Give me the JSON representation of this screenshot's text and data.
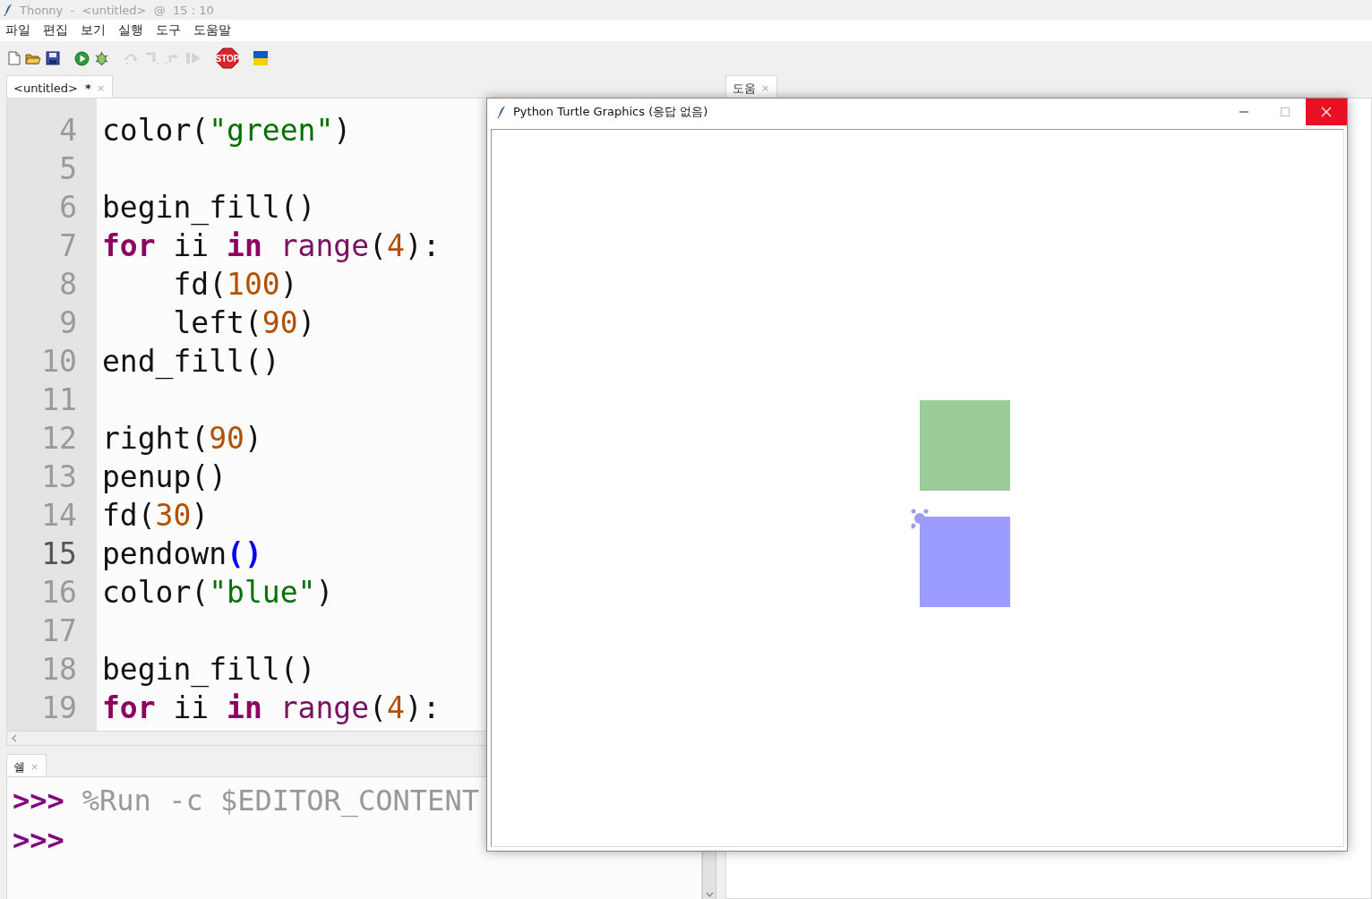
{
  "title_bar": {
    "text": "Thonny  -  <untitled>  @  15 : 10"
  },
  "menu": [
    "파일",
    "편집",
    "보기",
    "실행",
    "도구",
    "도움말"
  ],
  "toolbar": {
    "groups": [
      {
        "buttons": [
          {
            "kind": "new",
            "disabled": false
          },
          {
            "kind": "open",
            "disabled": false
          },
          {
            "kind": "save",
            "disabled": false
          }
        ]
      },
      {
        "buttons": [
          {
            "kind": "run",
            "disabled": false
          },
          {
            "kind": "debug",
            "disabled": false
          }
        ]
      },
      {
        "buttons": [
          {
            "kind": "step-over",
            "disabled": true
          },
          {
            "kind": "step-into",
            "disabled": true
          },
          {
            "kind": "step-out",
            "disabled": true
          },
          {
            "kind": "resume",
            "disabled": true
          }
        ]
      },
      {
        "buttons": [
          {
            "kind": "stop",
            "disabled": false,
            "label": "STOP"
          }
        ]
      },
      {
        "buttons": [
          {
            "kind": "flag",
            "disabled": false
          }
        ]
      }
    ]
  },
  "editor_tabs": [
    {
      "label": "<untitled>",
      "modified_mark": "*",
      "close": "×",
      "selected": true
    }
  ],
  "editor": {
    "lines": [
      {
        "number": "4",
        "current": false,
        "tokens": [
          {
            "text": "color(",
            "kind": "plain"
          },
          {
            "text": "\"green\"",
            "kind": "string"
          },
          {
            "text": ")",
            "kind": "plain"
          }
        ]
      },
      {
        "number": "5",
        "current": false
      },
      {
        "number": "6",
        "current": false,
        "tokens": [
          {
            "text": "begin_fill()",
            "kind": "plain"
          }
        ]
      },
      {
        "number": "7",
        "current": false,
        "tokens": [
          {
            "text": "for",
            "kind": "keyword"
          },
          {
            "text": " ii ",
            "kind": "plain"
          },
          {
            "text": "in",
            "kind": "keyword"
          },
          {
            "text": " range",
            "kind": "builtin"
          },
          {
            "text": "(",
            "kind": "plain"
          },
          {
            "text": "4",
            "kind": "number"
          },
          {
            "text": "):",
            "kind": "plain"
          }
        ]
      },
      {
        "number": "8",
        "current": false,
        "tokens": [
          {
            "text": "    fd(",
            "kind": "plain"
          },
          {
            "text": "100",
            "kind": "number"
          },
          {
            "text": ")",
            "kind": "plain"
          }
        ]
      },
      {
        "number": "9",
        "current": false,
        "tokens": [
          {
            "text": "    left(",
            "kind": "plain"
          },
          {
            "text": "90",
            "kind": "number"
          },
          {
            "text": ")",
            "kind": "plain"
          }
        ]
      },
      {
        "number": "10",
        "current": false,
        "tokens": [
          {
            "text": "end_fill()",
            "kind": "plain"
          }
        ]
      },
      {
        "number": "11",
        "current": false
      },
      {
        "number": "12",
        "current": false,
        "tokens": [
          {
            "text": "right(",
            "kind": "plain"
          },
          {
            "text": "90",
            "kind": "number"
          },
          {
            "text": ")",
            "kind": "plain"
          }
        ]
      },
      {
        "number": "13",
        "current": false,
        "tokens": [
          {
            "text": "penup()",
            "kind": "plain"
          }
        ]
      },
      {
        "number": "14",
        "current": false,
        "tokens": [
          {
            "text": "fd(",
            "kind": "plain"
          },
          {
            "text": "30",
            "kind": "number"
          },
          {
            "text": ")",
            "kind": "plain"
          }
        ]
      },
      {
        "number": "15",
        "current": true,
        "tokens": [
          {
            "text": "pendown",
            "kind": "plain"
          },
          {
            "text": "()",
            "kind": "match"
          }
        ]
      },
      {
        "number": "16",
        "current": false,
        "tokens": [
          {
            "text": "color(",
            "kind": "plain"
          },
          {
            "text": "\"blue\"",
            "kind": "string"
          },
          {
            "text": ")",
            "kind": "plain"
          }
        ]
      },
      {
        "number": "17",
        "current": false
      },
      {
        "number": "18",
        "current": false,
        "tokens": [
          {
            "text": "begin_fill()",
            "kind": "plain"
          }
        ]
      },
      {
        "number": "19",
        "current": false,
        "tokens": [
          {
            "text": "for",
            "kind": "keyword"
          },
          {
            "text": " ii ",
            "kind": "plain"
          },
          {
            "text": "in",
            "kind": "keyword"
          },
          {
            "text": " range",
            "kind": "builtin"
          },
          {
            "text": "(",
            "kind": "plain"
          },
          {
            "text": "4",
            "kind": "number"
          },
          {
            "text": "):",
            "kind": "plain"
          }
        ]
      }
    ]
  },
  "shell_tabs": [
    {
      "label": "쉘",
      "close": "×",
      "selected": true
    }
  ],
  "shell": {
    "lines": [
      {
        "prompt": ">>>",
        "command": "%Run -c $EDITOR_CONTENT"
      },
      {
        "prompt": ">>>"
      }
    ]
  },
  "help_tabs": [
    {
      "label": "도움",
      "close": "×",
      "selected": true
    }
  ],
  "turtle_window": {
    "title": "Python Turtle Graphics (응답 없음)"
  }
}
